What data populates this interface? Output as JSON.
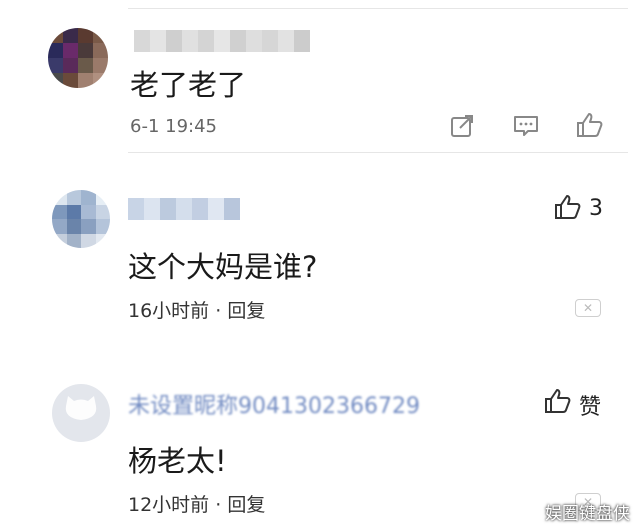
{
  "comments": [
    {
      "text": "老了老了",
      "timestamp": "6-1 19:45",
      "actions": [
        "share-icon",
        "comment-icon",
        "thumbs-up-icon"
      ]
    },
    {
      "text": "这个大妈是谁?",
      "likes": "3",
      "time": "16小时前",
      "separator": "·",
      "reply_label": "回复"
    },
    {
      "username_partial": "未设置昵称9041302366729",
      "text": "杨老太!",
      "like_label": "赞",
      "time": "12小时前",
      "separator": "·",
      "reply_label": "回复"
    }
  ],
  "watermark": "娱圈键盘侠",
  "colors": {
    "divider": "#e6e6e6",
    "username_blue": "#5a78b8"
  }
}
